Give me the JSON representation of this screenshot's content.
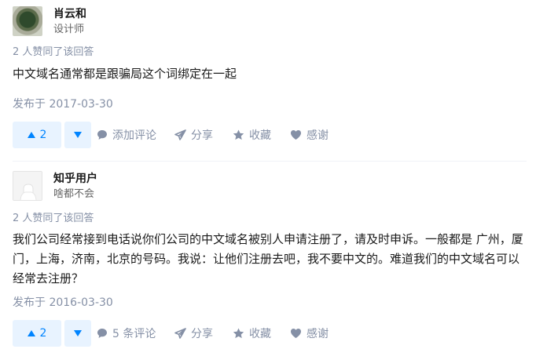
{
  "answers": [
    {
      "author": {
        "name": "肖云和",
        "bio": "设计师"
      },
      "vote_info": "2 人赞同了该回答",
      "content": "中文域名通常都是跟骗局这个词绑定在一起",
      "date": "发布于 2017-03-30",
      "actions": {
        "upvotes": "2",
        "comment": "添加评论",
        "share": "分享",
        "favorite": "收藏",
        "thanks": "感谢"
      }
    },
    {
      "author": {
        "name": "知乎用户",
        "bio": "啥都不会"
      },
      "vote_info": "2 人赞同了该回答",
      "content_lines": [
        "我们公司经常接到电话说你们公司的中文域名被别人申请注册了，请及时申诉。一般都是 广州，厦",
        "门，上海，济南，北京的号码。我说：让他们注册去吧，我不要中文的。难道我们的中文域名可以",
        "经常去注册？"
      ],
      "date": "发布于 2016-03-30",
      "actions": {
        "upvotes": "2",
        "comment": "5 条评论",
        "share": "分享",
        "favorite": "收藏",
        "thanks": "感谢"
      }
    }
  ],
  "colors": {
    "accent": "#0084ff",
    "accent_bg": "#e8f3ff",
    "muted": "#8590a6",
    "text": "#1a1a1a"
  },
  "icons": {
    "comment": "speech-bubble-icon",
    "share": "paper-plane-icon",
    "favorite": "star-icon",
    "thanks": "heart-icon",
    "upvote": "triangle-up-icon",
    "downvote": "triangle-down-icon"
  }
}
